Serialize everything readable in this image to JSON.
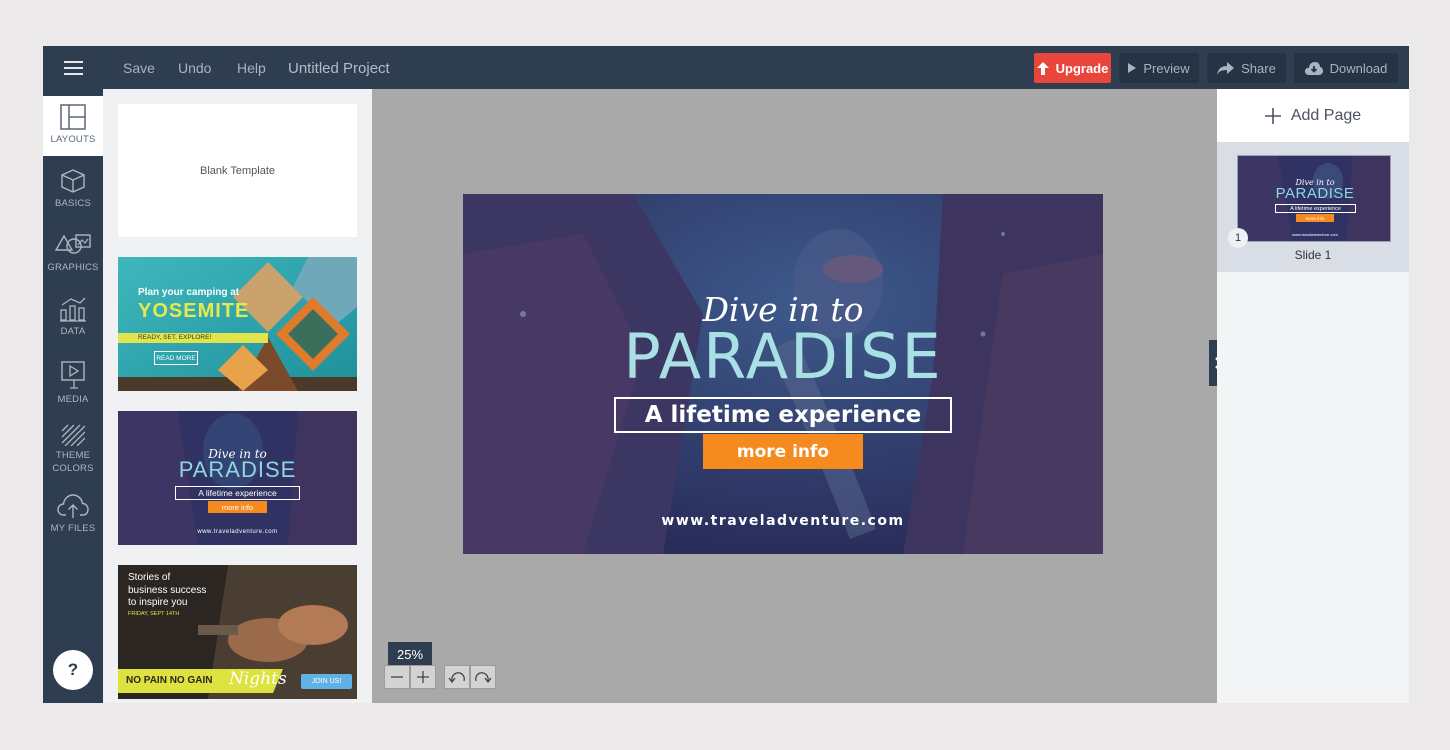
{
  "topbar": {
    "save_label": "Save",
    "undo_label": "Undo",
    "help_label": "Help",
    "project_title": "Untitled Project",
    "upgrade_label": "Upgrade",
    "preview_label": "Preview",
    "share_label": "Share",
    "download_label": "Download"
  },
  "rail": {
    "items": [
      {
        "label": "LAYOUTS",
        "icon": "layout-icon"
      },
      {
        "label": "BASICS",
        "icon": "cube-icon"
      },
      {
        "label": "GRAPHICS",
        "icon": "shapes-icon"
      },
      {
        "label": "DATA",
        "icon": "chart-icon"
      },
      {
        "label": "MEDIA",
        "icon": "play-icon"
      },
      {
        "label": "THEME",
        "label2": "COLORS",
        "icon": "stripes-icon"
      },
      {
        "label": "MY FILES",
        "icon": "cloud-upload-icon"
      }
    ],
    "help_label": "?"
  },
  "templates": {
    "blank_label": "Blank Template",
    "yosemite": {
      "line1": "Plan your camping at",
      "line2": "YOSEMITE",
      "line3": "READY, SET, EXPLORE!",
      "button": "READ MORE"
    },
    "paradise": {
      "line1": "Dive in to",
      "line2": "PARADISE",
      "line3": "A lifetime experience",
      "button": "more info",
      "url": "www.traveladventure.com"
    },
    "business": {
      "line1": "Stories of",
      "line2": "business success",
      "line3": "to inspire you",
      "date": "FRIDAY, SEPT 14TH",
      "banner": "NO PAIN NO GAIN",
      "script": "Nights",
      "button": "JOIN US!"
    }
  },
  "canvas": {
    "slide": {
      "script_title": "Dive in to",
      "big_title": "PARADISE",
      "subtitle": "A lifetime experience",
      "button": "more info",
      "url": "www.traveladventure.com"
    },
    "zoom_label": "25%"
  },
  "right_panel": {
    "add_page_label": "Add Page",
    "slides": [
      {
        "number": "1",
        "label": "Slide 1"
      }
    ]
  },
  "colors": {
    "topbar": "#2e3d50",
    "upgrade": "#e8453b",
    "accent_orange": "#f58a1f",
    "canvas_bg": "#a9a9a9"
  }
}
